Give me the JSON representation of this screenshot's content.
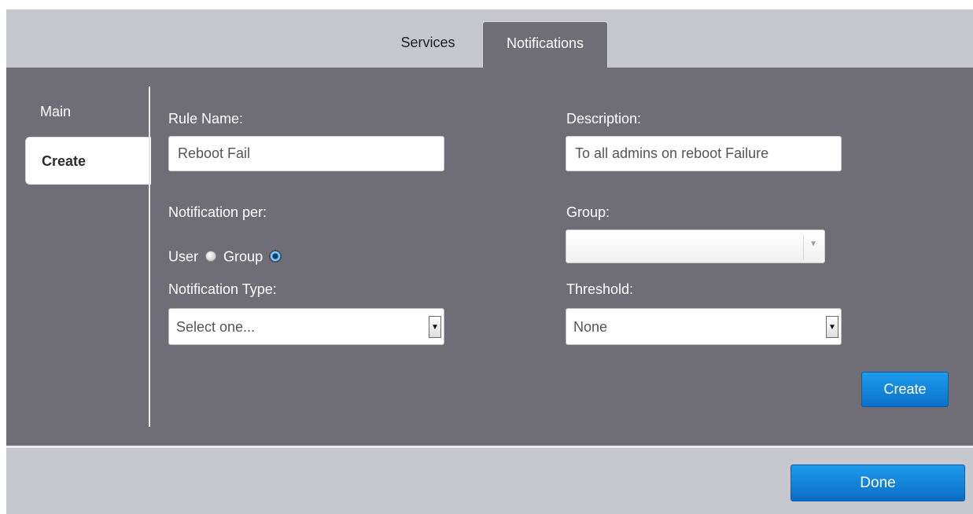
{
  "tabs": [
    {
      "label": "Services",
      "active": false
    },
    {
      "label": "Notifications",
      "active": true
    }
  ],
  "sidebar": {
    "items": [
      {
        "label": "Main",
        "active": false
      },
      {
        "label": "Create",
        "active": true
      }
    ]
  },
  "form": {
    "rule_name": {
      "label": "Rule Name:",
      "value": "Reboot Fail"
    },
    "description": {
      "label": "Description:",
      "value": "To all admins on reboot Failure"
    },
    "notification_per": {
      "label": "Notification per:",
      "options": [
        "User",
        "Group"
      ],
      "selected": "Group"
    },
    "group": {
      "label": "Group:",
      "value": ""
    },
    "notification_type": {
      "label": "Notification Type:",
      "value": "Select one..."
    },
    "threshold": {
      "label": "Threshold:",
      "value": "None"
    },
    "create_button": "Create"
  },
  "footer": {
    "done_button": "Done"
  },
  "colors": {
    "panel": "#6f6e76",
    "frame": "#c7c8cd",
    "button_blue": "#0b70c9"
  },
  "icons": {
    "select_arrow": "chevron-down-icon",
    "radio_selected": "radio-checked-icon",
    "radio_unselected": "radio-unchecked-icon"
  }
}
